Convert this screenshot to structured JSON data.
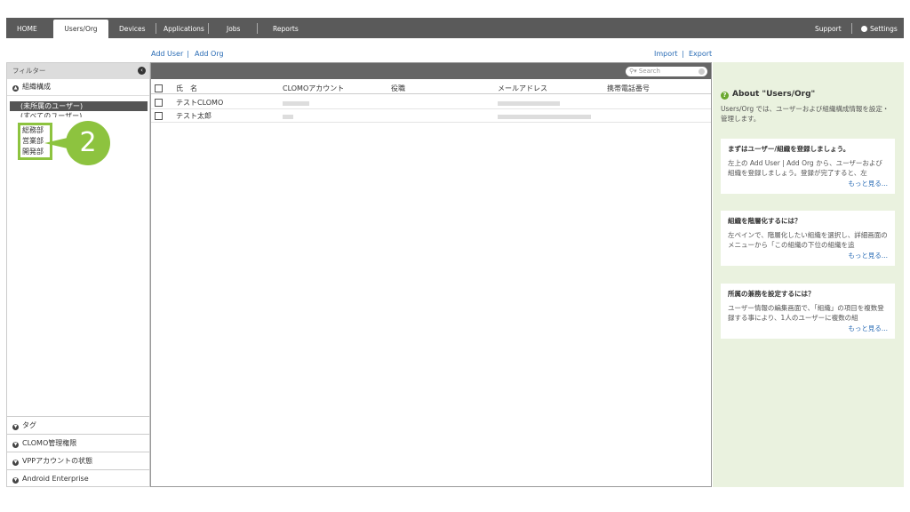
{
  "nav": {
    "home": "HOME",
    "users_org": "Users/Org",
    "devices": "Devices",
    "applications": "Applications",
    "jobs": "Jobs",
    "reports": "Reports",
    "support": "Support",
    "settings": "Settings"
  },
  "actions": {
    "add_user": "Add User",
    "add_org": "Add Org",
    "import": "Import",
    "export": "Export",
    "sep": "|"
  },
  "filter": {
    "title": "フィルター",
    "org_section": "組織構成",
    "unassigned": "(未所属のユーザー)",
    "all_users": "(すべてのユーザー)",
    "orgs": [
      "総務部",
      "営業部",
      "開発部"
    ],
    "tag": "タグ",
    "clomo_admin": "CLOMO管理権限",
    "vpp": "VPPアカウントの状態",
    "android": "Android Enterprise"
  },
  "step_badge": "2",
  "table": {
    "search_placeholder": "Search",
    "columns": [
      "氏　名",
      "CLOMOアカウント",
      "役職",
      "メールアドレス",
      "携帯電話番号"
    ],
    "rows": [
      {
        "name": "テストCLOMO"
      },
      {
        "name": "テスト太郎"
      }
    ]
  },
  "about": {
    "title": "About \"Users/Org\"",
    "desc": "Users/Org では、ユーザーおよび組織構成情報を設定・管理します。",
    "cards": [
      {
        "title": "まずはユーザー/組織を登録しましょう。",
        "text": "左上の Add User | Add Org から、ユーザーおよび組織を登録しましょう。登録が完了すると、左",
        "more": "もっと見る..."
      },
      {
        "title": "組織を階層化するには？",
        "text": "左ペインで、階層化したい組織を選択し、詳細画面のメニューから「この組織の下位の組織を追",
        "more": "もっと見る..."
      },
      {
        "title": "所属の兼務を設定するには？",
        "text": "ユーザー情報の編集画面で、「組織」の項目を複数登録する事により、1人のユーザーに複数の組",
        "more": "もっと見る..."
      }
    ]
  }
}
